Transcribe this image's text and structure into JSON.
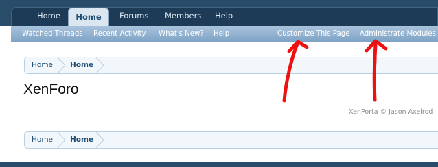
{
  "nav": {
    "tabs": [
      {
        "label": "Home"
      },
      {
        "label": "Home",
        "active": true
      },
      {
        "label": "Forums"
      },
      {
        "label": "Members"
      },
      {
        "label": "Help"
      }
    ]
  },
  "subnav": {
    "links": [
      {
        "label": "Watched Threads"
      },
      {
        "label": "Recent Activity"
      },
      {
        "label": "What's New?"
      },
      {
        "label": "Help"
      },
      {
        "label": "Customize This Page"
      },
      {
        "label": "Administrate Modules"
      }
    ]
  },
  "breadcrumb_top": [
    "Home",
    "Home"
  ],
  "page": {
    "title": "XenForo",
    "credit": "XenPorta © Jason Axelrod"
  },
  "breadcrumb_bottom": [
    "Home",
    "Home"
  ],
  "annotations": {
    "color": "#ee1111",
    "arrows": 2
  }
}
